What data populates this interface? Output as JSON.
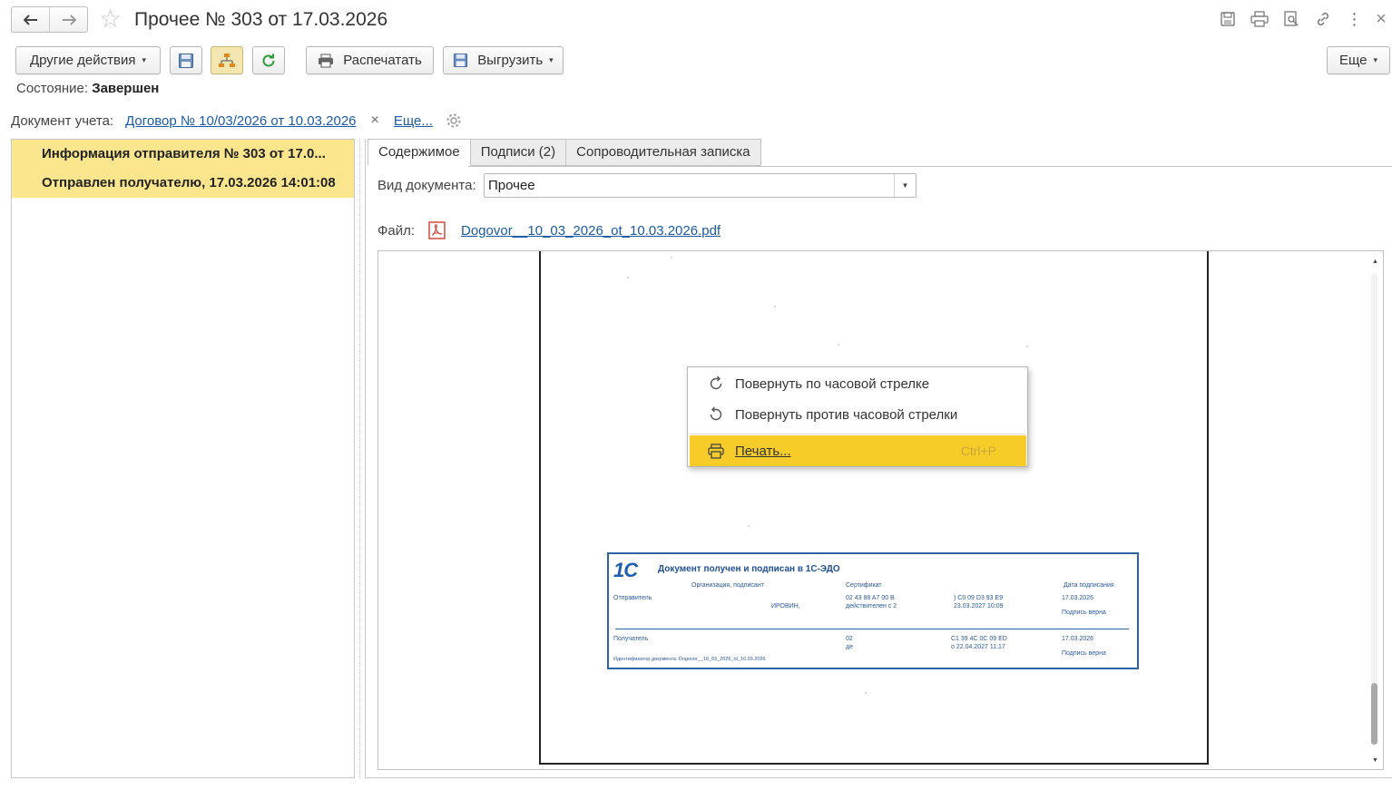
{
  "window": {
    "title": "Прочее № 303 от 17.03.2026",
    "back_icon": "arrow-left-icon",
    "forward_icon": "arrow-right-icon",
    "favorite_icon": "star-icon",
    "right_icons": [
      "save-icon",
      "print-icon",
      "preview-icon",
      "link-icon",
      "more-vertical-icon",
      "close-icon"
    ],
    "close_glyph": "×",
    "more_glyph": "⋮"
  },
  "toolbar": {
    "other_actions": "Другие действия",
    "print": "Распечатать",
    "export": "Выгрузить",
    "more": "Еще",
    "dropdown_glyph": "▾"
  },
  "status": {
    "label": "Состояние:",
    "value": "Завершен"
  },
  "accounting_doc": {
    "label": "Документ учета:",
    "link": "Договор № 10/03/2026 от 10.03.2026",
    "clear_glyph": "×",
    "more_link": "Еще..."
  },
  "left_list": {
    "items": [
      "Информация отправителя № 303 от 17.0...",
      "Отправлен получателю, 17.03.2026 14:01:08"
    ]
  },
  "tabs": [
    "Содержимое",
    "Подписи (2)",
    "Сопроводительная записка"
  ],
  "doc_type": {
    "label": "Вид документа:",
    "value": "Прочее"
  },
  "file": {
    "label": "Файл:",
    "name": "Dogovor__10_03_2026_ot_10.03.2026.pdf"
  },
  "stamp": {
    "logo": "1С",
    "title": "Документ получен и подписан в 1С-ЭДО",
    "col_org": "Организация, подписант",
    "col_cert": "Сертификат",
    "col_date": "Дата подписания",
    "sender_label": "Отправитель",
    "sender_name": "ИРОВИН,",
    "sender_cert_1": "02 43 88 A7 00 B",
    "sender_cert_2": "действителен с 2",
    "sender_cert_3": ") C0 09 D3 93 E9",
    "sender_cert_4": "23.03.2027 10:09",
    "sender_date": "17.03.2026",
    "sender_valid": "Подпись верна",
    "receiver_label": "Получатель",
    "receiver_cert_1": "02",
    "receiver_cert_2": "де",
    "receiver_cert_3": "C1 39 4C 0C 09 ED",
    "receiver_cert_4": "о 22.04.2027 11:17",
    "receiver_date": "17.03.2026",
    "receiver_valid": "Подпись верна",
    "doc_id": "Идентификатор документа: Dogovor__10_03_2026_ot_10.03.2026"
  },
  "context_menu": {
    "rotate_cw": "Повернуть по часовой стрелке",
    "rotate_ccw": "Повернуть против часовой стрелки",
    "print": "Печать...",
    "print_shortcut": "Ctrl+P"
  },
  "colors": {
    "accent_yellow": "#f7cc28",
    "list_highlight": "#fbe58d",
    "link_blue": "#1b5aa8"
  }
}
